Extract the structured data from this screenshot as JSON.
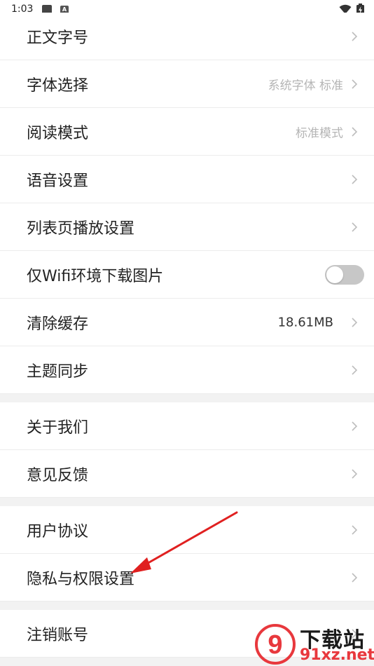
{
  "status_bar": {
    "time": "1:03",
    "notification_icon": "A"
  },
  "settings": {
    "section1": [
      {
        "label": "正文字号",
        "value": "",
        "kind": "chevron"
      },
      {
        "label": "字体选择",
        "value": "系统字体 标准",
        "kind": "chevron"
      },
      {
        "label": "阅读模式",
        "value": "标准模式",
        "kind": "chevron"
      },
      {
        "label": "语音设置",
        "value": "",
        "kind": "chevron"
      },
      {
        "label": "列表页播放设置",
        "value": "",
        "kind": "chevron"
      },
      {
        "label": "仅Wifi环境下载图片",
        "value": "",
        "kind": "toggle",
        "toggle_on": false
      },
      {
        "label": "清除缓存",
        "value": "18.61MB",
        "kind": "chevron"
      },
      {
        "label": "主题同步",
        "value": "",
        "kind": "chevron"
      }
    ],
    "section2": [
      {
        "label": "关于我们",
        "value": "",
        "kind": "chevron"
      },
      {
        "label": "意见反馈",
        "value": "",
        "kind": "chevron"
      }
    ],
    "section3": [
      {
        "label": "用户协议",
        "value": "",
        "kind": "chevron"
      },
      {
        "label": "隐私与权限设置",
        "value": "",
        "kind": "chevron"
      }
    ],
    "section4": [
      {
        "label": "注销账号",
        "value": "",
        "kind": "chevron"
      }
    ]
  },
  "annotation": {
    "arrow_color": "#e02020",
    "points_to": "隐私与权限设置"
  },
  "watermark": {
    "title": "下载站",
    "url": "91xz.net",
    "logo_glyph": "9"
  },
  "colors": {
    "accent_red": "#e8383d",
    "background": "#f2f2f2",
    "row_background": "#ffffff"
  }
}
